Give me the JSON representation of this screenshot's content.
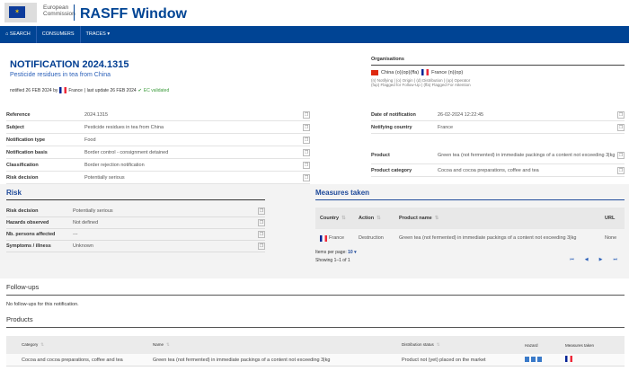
{
  "header": {
    "org_line1": "European",
    "org_line2": "Commission",
    "app_title": "RASFF Window"
  },
  "nav": {
    "search": "SEARCH",
    "consumers": "CONSUMERS",
    "traces": "TRACES ▾"
  },
  "notification": {
    "title": "NOTIFICATION 2024.1315",
    "subtitle": "Pesticide residues in tea from China",
    "notified": "notified 26 FEB 2024 by",
    "country": "France",
    "last_update": "| last update 26 FEB 2024",
    "validated": "EC validated"
  },
  "organisations": {
    "title": "Organisations",
    "china": "China (o)(op)(ffa)",
    "france": "France (n)(op)",
    "legend1": "(n) Notifying | (o) Origin | (d) Distribution | (op) Operator",
    "legend2": "(fup) Flagged for Follow-Up | (ffa) Flagged For Attention"
  },
  "details_left": [
    {
      "k": "Reference",
      "v": "2024.1315"
    },
    {
      "k": "Subject",
      "v": "Pesticide residues in tea from China"
    },
    {
      "k": "Notification type",
      "v": "Food"
    },
    {
      "k": "Notification basis",
      "v": "Border control - consignment detained"
    },
    {
      "k": "Classification",
      "v": "Border rejection notification"
    },
    {
      "k": "Risk decision",
      "v": "Potentially serious"
    }
  ],
  "details_right": [
    {
      "k": "Date of notification",
      "v": "26-02-2024 12:22:45"
    },
    {
      "k": "Notifying country",
      "v": "France"
    },
    {
      "k": "Product",
      "v": "Green tea (not fermented) in immediate packings of a content not exceeding 3|kg"
    },
    {
      "k": "Product category",
      "v": "Cocoa and cocoa preparations, coffee and tea"
    }
  ],
  "risk": {
    "title": "Risk",
    "rows": [
      {
        "k": "Risk decision",
        "v": "Potentially serious"
      },
      {
        "k": "Hazards observed",
        "v": "Not defined"
      },
      {
        "k": "Nb. persons affected",
        "v": "---"
      },
      {
        "k": "Symptoms / illness",
        "v": "Unknown"
      }
    ]
  },
  "measures": {
    "title": "Measures taken",
    "headers": [
      "Country",
      "Action",
      "Product name",
      "URL"
    ],
    "row": {
      "country": "France",
      "action": "Destruction",
      "product": "Green tea (not fermented) in immediate packings of a content not exceeding 3|kg",
      "url": "None"
    },
    "items_per_page_label": "Items per page:",
    "items_per_page": "10 ▾",
    "showing": "Showing 1–1 of 1"
  },
  "followups": {
    "title": "Follow-ups",
    "text": "No follow-ups for this notification."
  },
  "products": {
    "title": "Products",
    "headers": [
      "Category",
      "Name",
      "Distribution status",
      "Hazard",
      "Measures taken"
    ],
    "row": {
      "category": "Cocoa and cocoa preparations, coffee and tea",
      "name": "Green tea (not fermented) in immediate packings of a content not exceeding 3|kg",
      "status": "Product not (yet) placed on the market"
    }
  }
}
